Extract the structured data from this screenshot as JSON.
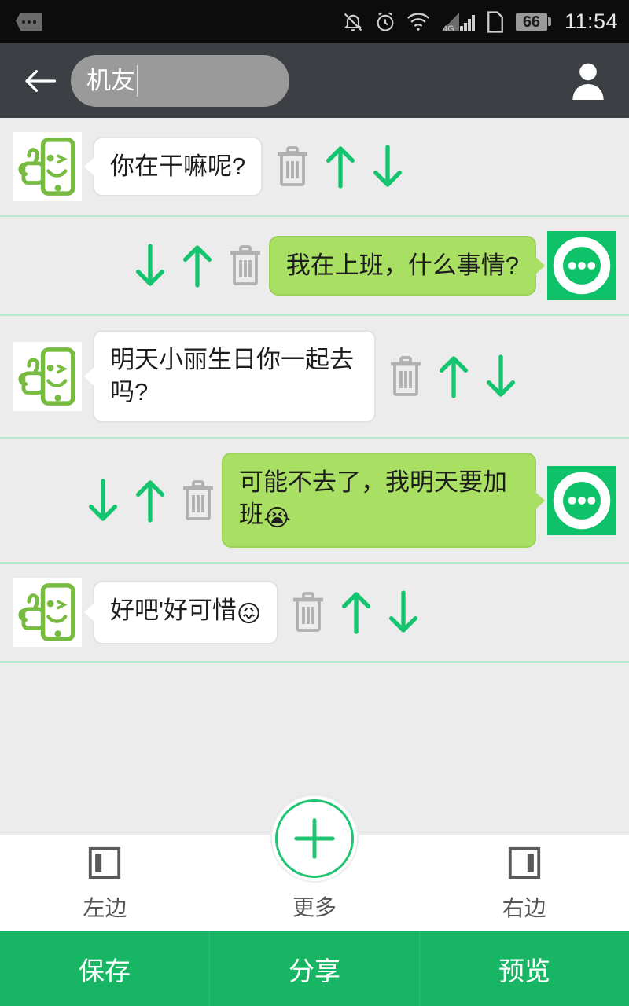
{
  "statusbar": {
    "sim_icon": "sim-dots-icon",
    "icons": [
      "bell-muted-icon",
      "alarm-clock-icon",
      "wifi-icon",
      "signal-4g-icon",
      "sim-card-icon"
    ],
    "network_label": "4G",
    "battery_level": "66",
    "time": "11:54"
  },
  "header": {
    "back_icon": "back-arrow-icon",
    "title_value": "机友",
    "avatar_icon": "person-icon"
  },
  "controls": {
    "delete_icon": "trash-icon",
    "move_up_icon": "arrow-up-icon",
    "move_down_icon": "arrow-down-icon"
  },
  "chat": {
    "messages": [
      {
        "side": "left",
        "avatar_icon": "phone-thumbsup-avatar-icon",
        "text": "你在干嘛呢?",
        "emoji": ""
      },
      {
        "side": "right",
        "avatar_icon": "green-dots-avatar-icon",
        "text": "我在上班，什么事情?",
        "emoji": ""
      },
      {
        "side": "left",
        "avatar_icon": "phone-thumbsup-avatar-icon",
        "text": "明天小丽生日你一起去吗?",
        "emoji": ""
      },
      {
        "side": "right",
        "avatar_icon": "green-dots-avatar-icon",
        "text": "可能不去了，我明天要加班",
        "emoji": "😭"
      },
      {
        "side": "left",
        "avatar_icon": "phone-thumbsup-avatar-icon",
        "text": "好吧'好可惜",
        "emoji": "😖"
      }
    ]
  },
  "bottom_nav": {
    "left": {
      "label": "左边",
      "icon": "align-left-icon"
    },
    "center": {
      "label": "更多",
      "icon": "plus-icon"
    },
    "right": {
      "label": "右边",
      "icon": "align-right-icon"
    }
  },
  "action_bar": {
    "save": "保存",
    "share": "分享",
    "preview": "预览"
  },
  "colors": {
    "accent_green": "#18b565",
    "bubble_green": "#a9e063",
    "header_dark": "#3c3f43",
    "divider_mint": "#b6e8cf",
    "background_gray": "#ececec"
  }
}
